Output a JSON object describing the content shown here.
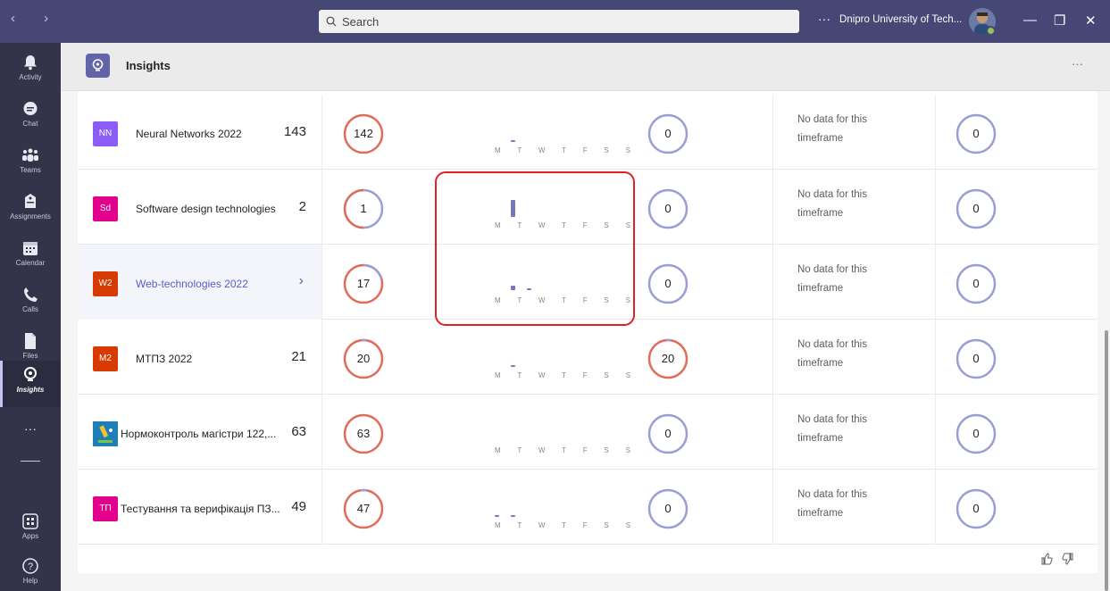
{
  "titlebar": {
    "nav_arrows": "‹  ›",
    "search_placeholder": "Search",
    "more": "···",
    "org_name": "Dnipro University of Tech...",
    "minimize": "—",
    "maximize": "❐",
    "close": "✕"
  },
  "rail": [
    {
      "label": "Activity",
      "icon": "bell-icon"
    },
    {
      "label": "Chat",
      "icon": "chat-icon"
    },
    {
      "label": "Teams",
      "icon": "teams-icon"
    },
    {
      "label": "Assignments",
      "icon": "assignments-icon"
    },
    {
      "label": "Calendar",
      "icon": "calendar-icon"
    },
    {
      "label": "Calls",
      "icon": "phone-icon"
    },
    {
      "label": "Files",
      "icon": "file-icon"
    },
    {
      "label": "Insights",
      "icon": "lightbulb-icon"
    },
    {
      "label": "···",
      "icon": "more-icon"
    },
    {
      "label": "Apps",
      "icon": "apps-icon"
    },
    {
      "label": "Help",
      "icon": "help-icon"
    }
  ],
  "header": {
    "title": "Insights",
    "more": "···"
  },
  "weekdays": "M T W T F S S",
  "nodata_text": "No data for this timeframe",
  "rows": [
    {
      "badge": "NN",
      "badge_color": "#8b5cf6",
      "name": "Neural Networks 2022",
      "count": "143",
      "ring1": "142",
      "ring2": "0",
      "ring3": "0"
    },
    {
      "badge": "Sd",
      "badge_color": "#e3008c",
      "name": "Software design technologies",
      "count": "2",
      "ring1": "1",
      "ring2": "0",
      "ring3": "0"
    },
    {
      "badge": "W2",
      "badge_color": "#d83b01",
      "name": "Web-technologies 2022",
      "count": "",
      "chevron": "›",
      "ring1": "17",
      "ring2": "0",
      "ring3": "0"
    },
    {
      "badge": "M2",
      "badge_color": "#d83b01",
      "name": "МТПЗ 2022",
      "count": "21",
      "ring1": "20",
      "ring2": "20",
      "ring3": "0"
    },
    {
      "badge": "",
      "badge_color": "#1e7fb8",
      "name": "Нормоконтроль магістри 122,...",
      "count": "63",
      "ring1": "63",
      "ring2": "0",
      "ring3": "0"
    },
    {
      "badge": "ТП",
      "badge_color": "#e3008c",
      "name": "Тестування та верифікація ПЗ...",
      "count": "49",
      "ring1": "47",
      "ring2": "0",
      "ring3": "0"
    }
  ],
  "footer": {
    "like": "👍",
    "dislike": "👎"
  },
  "colors": {
    "accent": "#6264a7",
    "ring_red": "#e06b5a",
    "ring_purple": "#9a9ed4",
    "highlight": "#e01f26"
  }
}
